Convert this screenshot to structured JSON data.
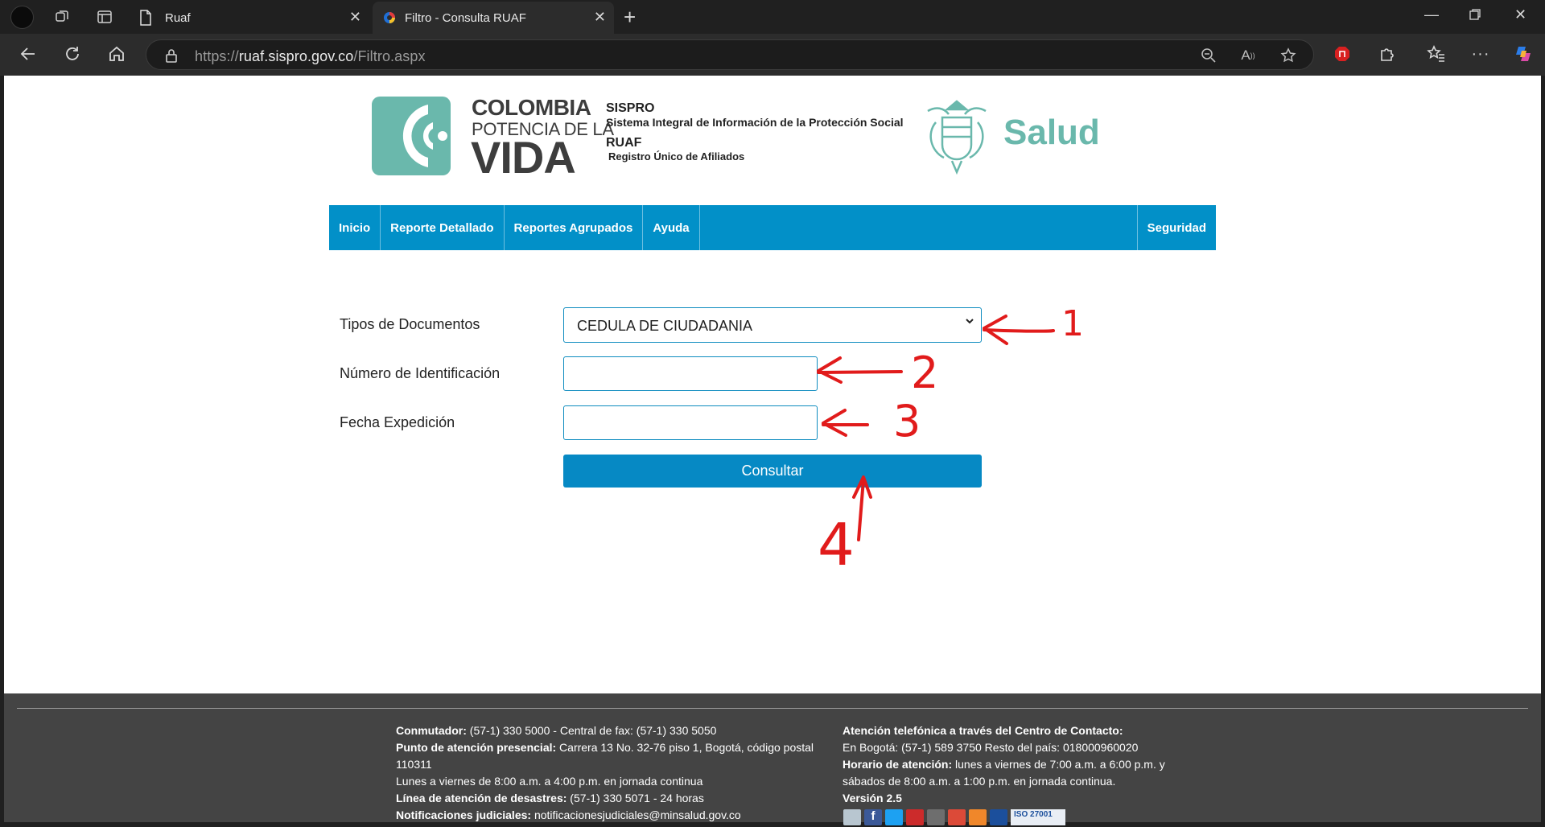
{
  "browser": {
    "tabs": [
      {
        "label": "Ruaf"
      },
      {
        "label": "Filtro - Consulta RUAF"
      }
    ],
    "url_prefix": "https://",
    "url_host": "ruaf.sispro.gov.co",
    "url_path": "/Filtro.aspx",
    "icons": [
      "profile-icon",
      "workspaces-icon",
      "tab-actions-icon",
      "page-icon",
      "edge-icon",
      "close-icon",
      "new-tab-icon",
      "minimize-icon",
      "restore-icon",
      "close-window-icon",
      "back-icon",
      "refresh-icon",
      "home-icon",
      "lock-icon",
      "zoom-out-icon",
      "read-aloud-icon",
      "favorite-icon",
      "adblock-icon",
      "extensions-icon",
      "favorites-icon",
      "more-icon",
      "copilot-icon"
    ]
  },
  "logos": {
    "colombia_line1": "COLOMBIA",
    "colombia_line2": "POTENCIA DE LA",
    "colombia_line3": "VIDA",
    "sispro_title": "SISPRO",
    "sispro_subtitle": "Sistema Integral de Información de la Protección Social",
    "ruaf_title": "RUAF",
    "ruaf_subtitle": "Registro Único de Afiliados",
    "salud": "Salud",
    "brand_color": "#6ab8ac"
  },
  "menu": {
    "items": [
      "Inicio",
      "Reporte Detallado",
      "Reportes Agrupados",
      "Ayuda"
    ],
    "security": "Seguridad",
    "color": "#0290c8"
  },
  "form": {
    "doc_type_label": "Tipos de Documentos",
    "doc_type_value": "CEDULA DE CIUDADANIA",
    "id_label": "Número de Identificación",
    "id_value": "",
    "date_label": "Fecha Expedición",
    "date_value": "",
    "submit_label": "Consultar"
  },
  "annotations": {
    "numbers": [
      "1",
      "2",
      "3",
      "4"
    ],
    "color": "#e11b1b"
  },
  "footer": {
    "left": {
      "conmutador_label": "Conmutador:",
      "conmutador_value": " (57-1) 330 5000 - Central de fax: (57-1) 330 5050",
      "punto_label": "Punto de atención presencial:",
      "punto_value": " Carrera 13 No. 32-76 piso 1, Bogotá, código postal 110311",
      "horario_presencial": "Lunes a viernes de 8:00 a.m. a 4:00 p.m. en jornada continua",
      "desastres_label": "Línea de atención de desastres:",
      "desastres_value": " (57-1) 330 5071 - 24 horas",
      "notificaciones_label": "Notificaciones judiciales:",
      "notificaciones_value": " notificacionesjudiciales@minsalud.gov.co"
    },
    "right": {
      "contacto_label": "Atención telefónica a través del Centro de Contacto:",
      "bogota": "En Bogotá: (57-1) 589 3750 Resto del país: 018000960020",
      "horario_label": "Horario de atención:",
      "horario_value": " lunes a viernes de 7:00 a.m. a 6:00 p.m. y sábados de 8:00 a.m. a 1:00 p.m. en jornada continua.",
      "version": "Versión 2.5",
      "iso": "ISO 27001",
      "social_icons": [
        "print-icon",
        "facebook-icon",
        "twitter-icon",
        "youtube-icon",
        "instagram-icon",
        "google-plus-icon",
        "rss-icon",
        "check-icon"
      ]
    }
  }
}
